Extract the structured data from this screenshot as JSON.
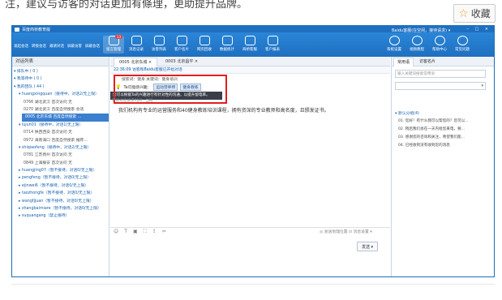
{
  "article": {
    "top_text": "注，建议与访客的对话更加有條理，更助提升品牌。",
    "favorite_label": "收藏"
  },
  "app": {
    "title": "百度商桥教育版",
    "status": "Baidu客服(在空闲，接待请求) ▾",
    "left_toolbar": [
      "发起会话",
      "转接会话",
      "邀请对话",
      "屏蔽访客",
      "屏蔽会话"
    ],
    "toolbar": [
      {
        "label": "留言管理",
        "badge": "13",
        "icon": "envelope-icon"
      },
      {
        "label": "消息记录",
        "icon": "clock-icon"
      },
      {
        "label": "访客列表",
        "icon": "list-icon"
      },
      {
        "label": "客户名片",
        "icon": "card-icon"
      },
      {
        "label": "网页回收",
        "icon": "inbox-icon"
      },
      {
        "label": "数据统计",
        "icon": "chart-icon"
      },
      {
        "label": "商桥客服",
        "icon": "chat-icon"
      },
      {
        "label": "客户报表",
        "icon": "report-icon"
      }
    ],
    "right_toolbar": [
      {
        "label": "系统设置",
        "icon": "gear-icon"
      },
      {
        "label": "视频教程",
        "icon": "video-icon"
      },
      {
        "label": "帮助中心",
        "icon": "question-icon"
      },
      {
        "label": "常见问题",
        "icon": "info-icon"
      }
    ]
  },
  "left_panel": {
    "header": "对话列表",
    "rows": [
      {
        "text": "▾ 排队中 ( 0 )",
        "kind": "g"
      },
      {
        "text": "▾ 我等待中 ( 0 )",
        "kind": "g"
      },
      {
        "text": "▾ 我的团队 ( 44 )",
        "kind": "g"
      },
      {
        "text": "▾ huangxingquan（接待中，对话2/无上限）",
        "kind": "sub2"
      },
      {
        "text": "0766 湖北武汉  首次访问 无",
        "kind": "sub"
      },
      {
        "text": "0270 湖北武汉  百度自然搜索 会话",
        "kind": "sub"
      },
      {
        "text": "0005 北京东城  百度自然搜索 ...",
        "kind": "sel"
      },
      {
        "text": "▾ lujun01（接待中，对话1/无上限）",
        "kind": "sub2"
      },
      {
        "text": "0714 陕西西安  首次访问 无",
        "kind": "sub"
      },
      {
        "text": "0972 海南海口  百度自然搜索 推荐...",
        "kind": "sub"
      },
      {
        "text": "▾ shiqiaofeng（接待中，对话2/无上限）",
        "kind": "sub2"
      },
      {
        "text": "0781 江苏扬州  首次访问 无",
        "kind": "sub"
      },
      {
        "text": "0849 上海静安  首次访问 无",
        "kind": "sub"
      },
      {
        "text": "▸ huangjing07（暂不接待，对话0/无上限）",
        "kind": "sub2"
      },
      {
        "text": "▸ pengfeng（暂不接待，对话0/无上限）",
        "kind": "sub2"
      },
      {
        "text": "▸ ejinwei6（暂不接待，对话0/无上限）",
        "kind": "sub2"
      },
      {
        "text": "▸ taozhongfe（暂不接待，对话0/无上限）",
        "kind": "sub2"
      },
      {
        "text": "▸ wangfjjuan（暂不接待，对话0/无上限）",
        "kind": "sub2"
      },
      {
        "text": "▸ zhangbaimiare（暂不接待，对话0/无上限）",
        "kind": "sub2"
      },
      {
        "text": "▸ suquangang（禁止接待）",
        "kind": "sub2"
      }
    ]
  },
  "center": {
    "tabs": [
      "0005 北京东城 ×",
      "0003 北京昌平 ×"
    ],
    "info": "22:36:09  访客和Baidu客服已开始对话",
    "search_label": "搜索词：健身          关键词：健身培训",
    "hint_prefix": "Ta可能感兴趣：",
    "chips": [
      "运动营养师",
      "健身教练"
    ],
    "tooltip": "您可以根据Ta的兴趣进行有针对性的沟通，以提升留电率。",
    "transfer": "转接对话请求时间：当班 ...",
    "message": "我们机构有专业的运营服务和40健身教练培训课程，拥有资深的专业教师和高名度，且颁发证书。",
    "tools": [
      "☺",
      "T",
      "▣",
      "⛶",
      "⇪",
      "✂"
    ],
    "location": "◎ 发送地理位置",
    "reply": "⊡ 消息设置 ▾",
    "send": "发送 ▾"
  },
  "right_panel": {
    "tabs": [
      "常用语",
      "访客名片"
    ],
    "search_placeholder": "输入关键词搜索常用语",
    "category": "▾ 默认分组(4)",
    "items": [
      "01. 您好！有什么我可以帮您的？您可以...",
      "02. 稍后我们会在一天内给您来电，要...",
      "03. 感谢您的咨询和关注，希望我们能...",
      "04. 已经收到没有收到您的消息"
    ]
  }
}
